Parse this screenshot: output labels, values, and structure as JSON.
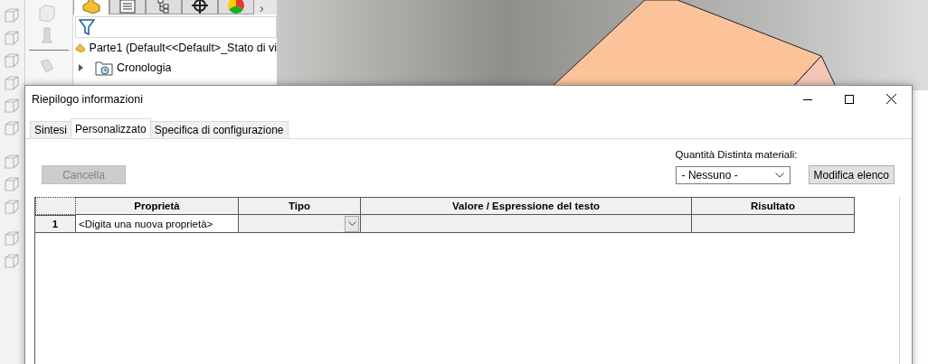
{
  "feature_manager": {
    "tabs": [
      {
        "selected": true
      },
      {
        "selected": false
      },
      {
        "selected": false
      },
      {
        "selected": false
      },
      {
        "selected": false
      }
    ],
    "more": "›",
    "tree": [
      {
        "label": "Parte1  (Default<<Default>_Stato di vi",
        "kind": "part"
      },
      {
        "label": "Cronologia",
        "kind": "folder",
        "expanded": false
      }
    ]
  },
  "dialog": {
    "title": "Riepilogo informazioni",
    "tabs": [
      {
        "label": "Sintesi",
        "selected": false
      },
      {
        "label": "Personalizzato",
        "selected": true
      },
      {
        "label": "Specifica di configurazione",
        "selected": false
      }
    ],
    "delete_button": {
      "label": "Cancella",
      "disabled": true
    },
    "bom_label": "Quantità Distinta materiali:",
    "bom_select": {
      "value": "- Nessuno -"
    },
    "edit_list_button": {
      "label": "Modifica elenco",
      "disabled": false
    },
    "table": {
      "columns": [
        "Proprietà",
        "Tipo",
        "Valore / Espressione del testo",
        "Risultato"
      ],
      "rows": [
        {
          "number": "1",
          "property": "<Digita una nuova proprietà>"
        }
      ]
    }
  }
}
